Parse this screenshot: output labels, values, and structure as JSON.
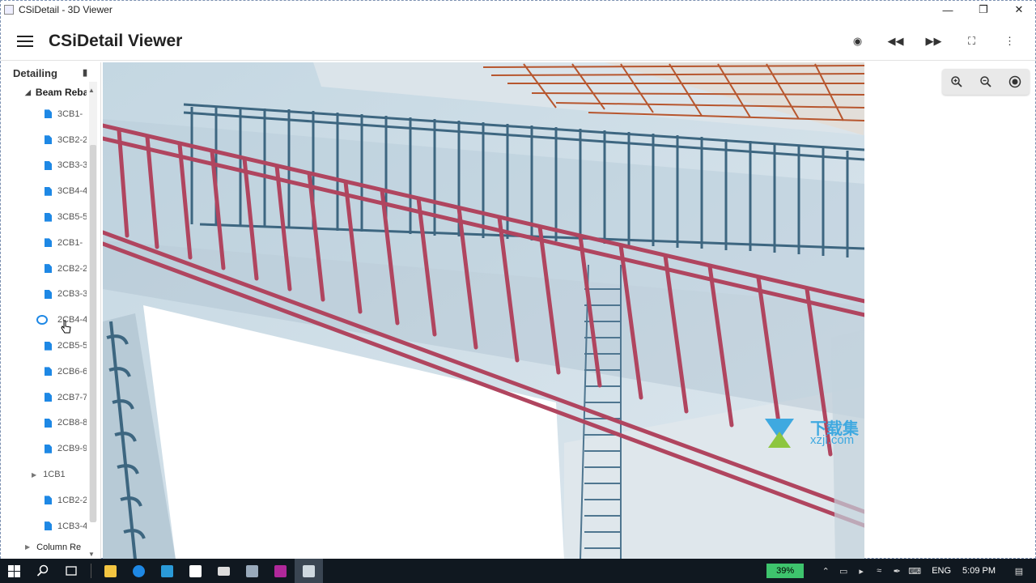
{
  "window": {
    "title": "CSiDetail - 3D Viewer",
    "min_icon": "minimize-icon",
    "restore_icon": "restore-icon",
    "close_icon": "close-icon"
  },
  "appbar": {
    "title": "CSiDetail Viewer",
    "actions": [
      {
        "name": "record-icon",
        "glyph": "◉"
      },
      {
        "name": "rewind-icon",
        "glyph": "◀◀"
      },
      {
        "name": "fast-forward-icon",
        "glyph": "▶▶"
      },
      {
        "name": "fit-screen-icon",
        "glyph": "⛶"
      },
      {
        "name": "more-vert-icon",
        "glyph": "⋮"
      }
    ]
  },
  "sidebar": {
    "header": "Detailing",
    "group": "Beam Reba",
    "items": [
      {
        "label": "3CB1-"
      },
      {
        "label": "3CB2-2"
      },
      {
        "label": "3CB3-3"
      },
      {
        "label": "3CB4-4"
      },
      {
        "label": "3CB5-5"
      },
      {
        "label": "2CB1-"
      },
      {
        "label": "2CB2-2"
      },
      {
        "label": "2CB3-3"
      },
      {
        "label": "2CB4-4"
      },
      {
        "label": "2CB5-5"
      },
      {
        "label": "2CB6-6"
      },
      {
        "label": "2CB7-7"
      },
      {
        "label": "2CB8-8"
      },
      {
        "label": "2CB9-9"
      }
    ],
    "subgroup": "1CB1",
    "items2": [
      {
        "label": "1CB2-2"
      },
      {
        "label": "1CB3-4"
      }
    ],
    "footer_group": "Column Re"
  },
  "zoombar": {
    "icons": [
      "zoom-in-icon",
      "zoom-out-icon",
      "center-icon"
    ]
  },
  "watermark": {
    "top": "下载集",
    "bottom": "xzji.com"
  },
  "taskbar": {
    "battery": "39%",
    "language": "ENG",
    "time": "5:09 PM"
  },
  "colors": {
    "rebar_red": "#b0455f",
    "rebar_blue": "#3d6680",
    "rebar_orange": "#b7562e",
    "accent": "#1e88e5"
  }
}
